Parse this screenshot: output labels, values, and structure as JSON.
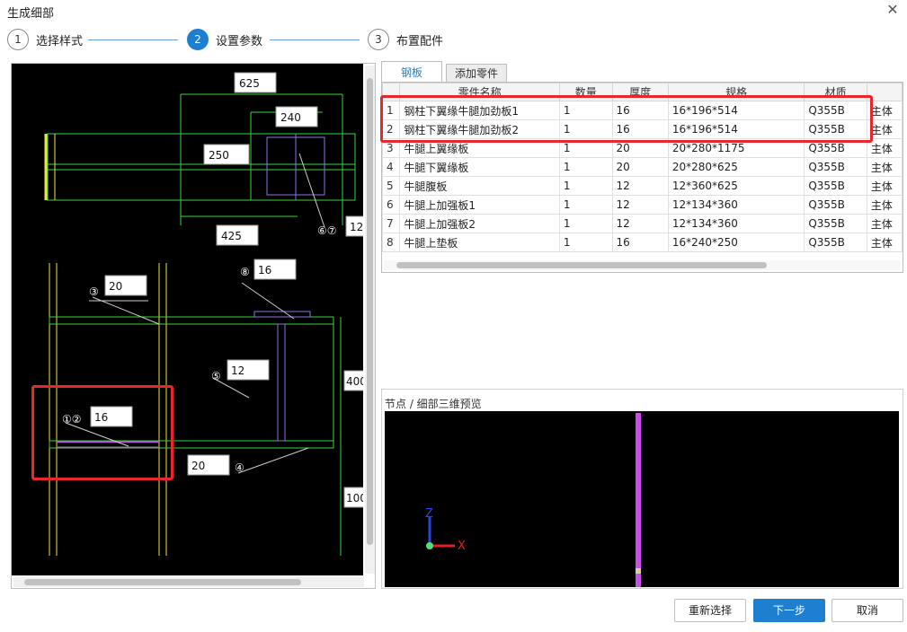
{
  "window": {
    "title": "生成细部"
  },
  "steps": [
    {
      "num": "1",
      "label": "选择样式"
    },
    {
      "num": "2",
      "label": "设置参数"
    },
    {
      "num": "3",
      "label": "布置配件"
    }
  ],
  "drawing": {
    "dims": [
      "625",
      "240",
      "250",
      "425",
      "12",
      "20",
      "16",
      "12",
      "400",
      "16",
      "20",
      "100"
    ],
    "markers": [
      "③",
      "⑧",
      "⑤",
      "①②",
      "④",
      "⑥⑦"
    ]
  },
  "tabs": [
    {
      "label": "钢板"
    },
    {
      "label": "添加零件"
    }
  ],
  "table": {
    "columns": [
      "",
      "零件名称",
      "数量",
      "厚度",
      "规格",
      "材质",
      ""
    ],
    "rows": [
      {
        "idx": "1",
        "name": "钢柱下翼缘牛腿加劲板1",
        "qty": "1",
        "thk": "16",
        "spec": "16*196*514",
        "mat": "Q355B",
        "extra": "主体"
      },
      {
        "idx": "2",
        "name": "钢柱下翼缘牛腿加劲板2",
        "qty": "1",
        "thk": "16",
        "spec": "16*196*514",
        "mat": "Q355B",
        "extra": "主体"
      },
      {
        "idx": "3",
        "name": "牛腿上翼缘板",
        "qty": "1",
        "thk": "20",
        "spec": "20*280*1175",
        "mat": "Q355B",
        "extra": "主体"
      },
      {
        "idx": "4",
        "name": "牛腿下翼缘板",
        "qty": "1",
        "thk": "20",
        "spec": "20*280*625",
        "mat": "Q355B",
        "extra": "主体"
      },
      {
        "idx": "5",
        "name": "牛腿腹板",
        "qty": "1",
        "thk": "12",
        "spec": "12*360*625",
        "mat": "Q355B",
        "extra": "主体"
      },
      {
        "idx": "6",
        "name": "牛腿上加强板1",
        "qty": "1",
        "thk": "12",
        "spec": "12*134*360",
        "mat": "Q355B",
        "extra": "主体"
      },
      {
        "idx": "7",
        "name": "牛腿上加强板2",
        "qty": "1",
        "thk": "12",
        "spec": "12*134*360",
        "mat": "Q355B",
        "extra": "主体"
      },
      {
        "idx": "8",
        "name": "牛腿上垫板",
        "qty": "1",
        "thk": "16",
        "spec": "16*240*250",
        "mat": "Q355B",
        "extra": "主体"
      }
    ]
  },
  "preview": {
    "label": "节点 / 细部三维预览",
    "axis_z": "Z",
    "axis_x": "X"
  },
  "buttons": {
    "reselect": "重新选择",
    "next": "下一步",
    "cancel": "取消"
  },
  "colors": {
    "accent": "#1e7fd0",
    "highlight": "#e8262b",
    "drawing_green": "#39d43a",
    "drawing_purple": "#c84ee8"
  },
  "icons": {
    "close": "close-icon"
  }
}
